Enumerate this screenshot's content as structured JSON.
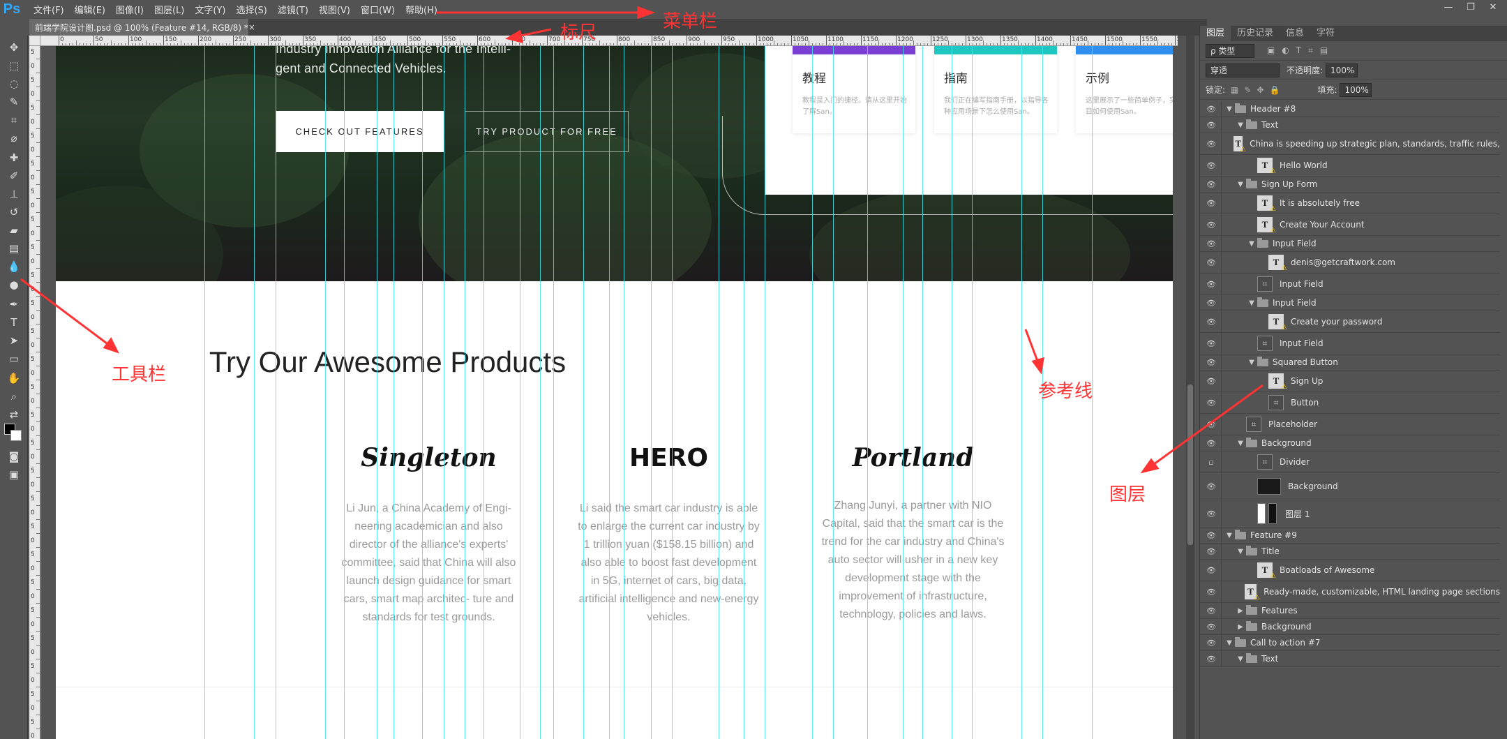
{
  "app": {
    "logo": "Ps"
  },
  "menu": [
    "文件(F)",
    "编辑(E)",
    "图像(I)",
    "图层(L)",
    "文字(Y)",
    "选择(S)",
    "滤镜(T)",
    "视图(V)",
    "窗口(W)",
    "帮助(H)"
  ],
  "window_controls": [
    "—",
    "❐",
    "✕"
  ],
  "document_tab": {
    "title": "前端学院设计图.psd @ 100% (Feature #14, RGB/8) *",
    "close": "×"
  },
  "ruler_ticks": [
    "0",
    "50",
    "100",
    "150",
    "200",
    "250",
    "300",
    "350",
    "400",
    "450",
    "500",
    "550",
    "600",
    "650",
    "700",
    "750",
    "800",
    "850",
    "900",
    "950",
    "1000",
    "1050",
    "1100",
    "1150",
    "1200",
    "1250",
    "1300",
    "1350",
    "1400",
    "1450",
    "1500",
    "1550",
    "160"
  ],
  "ruler_left_ticks": [
    "5",
    "0",
    "5",
    "0",
    "5",
    "0",
    "5",
    "0",
    "5",
    "0",
    "5",
    "0",
    "5",
    "0",
    "5",
    "0",
    "5",
    "0",
    "5",
    "0",
    "5",
    "0",
    "5",
    "0",
    "5",
    "0",
    "5",
    "0",
    "5",
    "0",
    "5",
    "0",
    "5",
    "0",
    "5",
    "0",
    "5",
    "0",
    "5",
    "0",
    "5",
    "0",
    "5",
    "0",
    "5",
    "0",
    "5",
    "0",
    "5",
    "0"
  ],
  "canvas": {
    "hero_text": [
      "Industry Innovation Alliance for the Intelli-",
      "gent and Connected Vehicles."
    ],
    "btn_features": "CHECK OUT FEATURES",
    "btn_free": "TRY PRODUCT FOR FREE",
    "cards": [
      {
        "title": "教程",
        "desc": "教程是入门的捷径。请从这里开始了解San。",
        "color": "#7b3fd6"
      },
      {
        "title": "指南",
        "desc": "我们正在编写指南手册，以指导各种应用场景下怎么使用San。",
        "color": "#1ec8c0"
      },
      {
        "title": "示例",
        "desc": "这里展示了一些简单例子，实际项目如何使用San。",
        "color": "#2f8ff0"
      }
    ],
    "products_title": "Try Our Awesome Products",
    "products": [
      {
        "logo": "Singleton",
        "desc": "Li Jun, a China Academy of Engi- neering academician and also director of the alliance's experts' committee, said that China will also launch design guidance for smart cars, smart map architec- ture and standards for test grounds."
      },
      {
        "logo": "HERO",
        "desc": "Li said the smart car industry is able to enlarge the current car industry by 1 trillion yuan ($158.15 billion) and also able to boost fast development in 5G, internet of cars, big data, artificial intelligence and new-energy vehicles."
      },
      {
        "logo": "Portland",
        "desc": "Zhang Junyi, a partner with NIO Capital, said that the smart car is the trend for the car industry and China's auto sector will usher in a new key development stage with the improvement of infrastructure, technology, policies and laws."
      }
    ]
  },
  "panel": {
    "tabs": [
      "图层",
      "历史记录",
      "信息",
      "字符"
    ],
    "filter_label": "ρ 类型",
    "blend_mode": "穿透",
    "opacity_label": "不透明度:",
    "opacity_value": "100%",
    "lock_label": "锁定:",
    "fill_label": "填充:",
    "fill_value": "100%",
    "layers": [
      {
        "name": "Header #8",
        "kind": "group",
        "level": 0,
        "open": true
      },
      {
        "name": "Text",
        "kind": "group",
        "level": 1,
        "open": true
      },
      {
        "name": "China is speeding up strategic plan, standards, traffic rules,",
        "kind": "text",
        "level": 2
      },
      {
        "name": "Hello World",
        "kind": "text",
        "level": 2
      },
      {
        "name": "Sign Up Form",
        "kind": "group",
        "level": 1,
        "open": true
      },
      {
        "name": "It is absolutely free",
        "kind": "text",
        "level": 2
      },
      {
        "name": "Create Your Account",
        "kind": "text",
        "level": 2
      },
      {
        "name": "Input Field",
        "kind": "group",
        "level": 2,
        "open": true
      },
      {
        "name": "denis@getcraftwork.com",
        "kind": "text",
        "level": 3
      },
      {
        "name": "Input Field",
        "kind": "shape",
        "level": 2
      },
      {
        "name": "Input Field",
        "kind": "group",
        "level": 2,
        "open": true
      },
      {
        "name": "Create your password",
        "kind": "text",
        "level": 3
      },
      {
        "name": "Input Field",
        "kind": "shape",
        "level": 2
      },
      {
        "name": "Squared Button",
        "kind": "group",
        "level": 2,
        "open": true
      },
      {
        "name": "Sign Up",
        "kind": "text",
        "level": 3
      },
      {
        "name": "Button",
        "kind": "shape",
        "level": 3
      },
      {
        "name": "Placeholder",
        "kind": "shape",
        "level": 1
      },
      {
        "name": "Background",
        "kind": "group",
        "level": 1,
        "open": true
      },
      {
        "name": "Divider",
        "kind": "shape",
        "level": 2,
        "hidden": true
      },
      {
        "name": "Background",
        "kind": "dark",
        "level": 2
      },
      {
        "name": "图层 1",
        "kind": "mask",
        "level": 2
      },
      {
        "name": "Feature #9",
        "kind": "group",
        "level": 0,
        "open": true
      },
      {
        "name": "Title",
        "kind": "group",
        "level": 1,
        "open": true
      },
      {
        "name": "Boatloads of Awesome",
        "kind": "text",
        "level": 2
      },
      {
        "name": "Ready-made, customizable, HTML landing page sections",
        "kind": "text",
        "level": 2
      },
      {
        "name": "Features",
        "kind": "group",
        "level": 1,
        "open": false
      },
      {
        "name": "Background",
        "kind": "group",
        "level": 1,
        "open": false
      },
      {
        "name": "Call to action #7",
        "kind": "group",
        "level": 0,
        "open": true
      },
      {
        "name": "Text",
        "kind": "group",
        "level": 1,
        "open": true
      }
    ]
  },
  "annotations": {
    "ruler": "标尺",
    "menubar": "菜单栏",
    "toolbar": "工具栏",
    "guides": "参考线",
    "layers": "图层"
  },
  "colors": {
    "guide": "#3ee8ee",
    "annotation": "#ff3333",
    "ps_blue": "#31a8ff"
  }
}
